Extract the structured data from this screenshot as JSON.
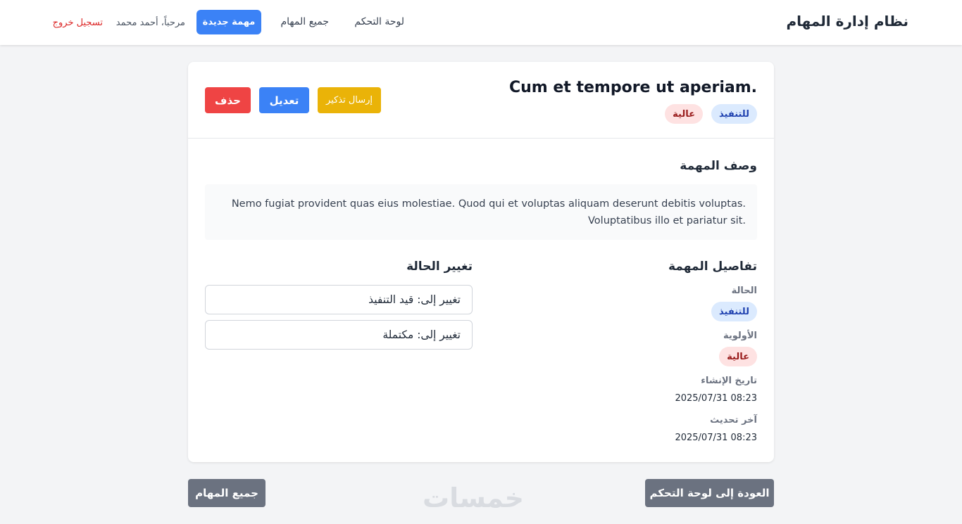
{
  "navbar": {
    "brand": "نظام إدارة المهام",
    "links": {
      "dashboard": "لوحة التحكم",
      "all_tasks": "جميع المهام"
    },
    "new_task_button": "مهمة جديدة",
    "welcome_text": "مرحباً، أحمد محمد",
    "logout": "تسجيل خروج"
  },
  "task": {
    "title": "Cum et tempore ut aperiam.",
    "status": "للتنفيذ",
    "priority": "عالية",
    "actions": {
      "send_reminder": "إرسال تذكير",
      "edit": "تعديل",
      "delete": "حذف"
    },
    "description_heading": "وصف المهمة",
    "description_lines": [
      "Nemo fugiat provident quas eius molestiae. Quod qui et voluptas aliquam deserunt debitis voluptas.",
      "Voluptatibus illo et pariatur sit."
    ],
    "details": {
      "heading": "تفاصيل المهمة",
      "status_label": "الحالة",
      "priority_label": "الأولوية",
      "created_label": "تاريخ الإنشاء",
      "created_value": "2025/07/31 08:23",
      "updated_label": "آخر تحديث",
      "updated_value": "2025/07/31 08:23"
    },
    "change_status": {
      "heading": "تغيير الحالة",
      "to_in_progress": "تغيير إلى: قيد التنفيذ",
      "to_completed": "تغيير إلى: مكتملة"
    }
  },
  "footer": {
    "back_to_dashboard": "العودة إلى لوحة التحكم",
    "all_tasks": "جميع المهام"
  },
  "watermark": "خمسات",
  "colors": {
    "primary": "#3b82f6",
    "warning": "#eab308",
    "danger": "#ef4444",
    "secondary": "#6b7280",
    "logout": "#dc2626",
    "status_badge_bg": "#dbeafe",
    "priority_badge_bg": "#fee2e2"
  }
}
